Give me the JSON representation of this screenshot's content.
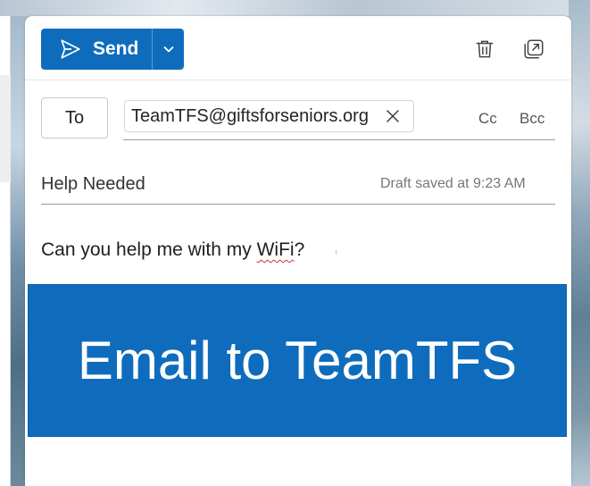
{
  "colors": {
    "accent": "#0f6cbd",
    "spellcheck": "#d13438"
  },
  "toolbar": {
    "send_label": "Send",
    "send_icon": "paper-plane-icon",
    "send_options_icon": "chevron-down-icon",
    "delete_icon": "trash-icon",
    "popout_icon": "popout-icon"
  },
  "recipients": {
    "to_label": "To",
    "to_address": "TeamTFS@giftsforseniors.org",
    "remove_icon": "close-icon",
    "cc_label": "Cc",
    "bcc_label": "Bcc"
  },
  "subject": {
    "value": "Help Needed",
    "draft_status": "Draft saved at 9:23 AM"
  },
  "message": {
    "text_before": "Can you help me with my ",
    "misspelled_word": "WiFi",
    "text_after": "?"
  },
  "banner": {
    "text": "Email to TeamTFS"
  }
}
